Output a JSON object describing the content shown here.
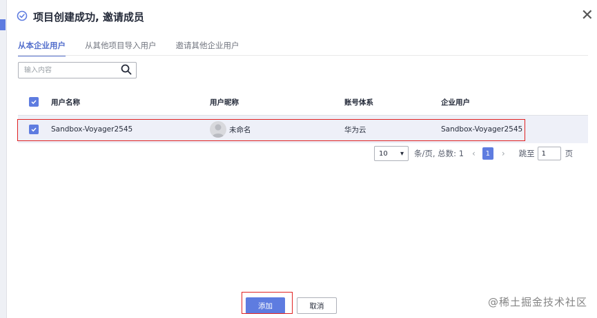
{
  "dialog": {
    "title": "项目创建成功, 邀请成员",
    "close_icon": "close-icon",
    "accent_color": "#5e7ce0"
  },
  "tabs": [
    {
      "label": "从本企业用户",
      "active": true
    },
    {
      "label": "从其他项目导入用户",
      "active": false
    },
    {
      "label": "邀请其他企业用户",
      "active": false
    }
  ],
  "search": {
    "placeholder": "输入内容",
    "icon": "search-icon"
  },
  "table": {
    "headers": [
      "用户名称",
      "用户昵称",
      "账号体系",
      "企业用户"
    ],
    "rows": [
      {
        "checked": true,
        "username": "Sandbox-Voyager2545",
        "nickname": "未命名",
        "account_system": "华为云",
        "enterprise_user": "Sandbox-Voyager2545"
      }
    ]
  },
  "pagination": {
    "page_size": "10",
    "summary": "条/页, 总数: 1",
    "current_page": "1",
    "goto_label": "跳至",
    "goto_value": "1",
    "page_unit": "页"
  },
  "footer": {
    "add_label": "添加",
    "cancel_label": "取消"
  },
  "watermark": "@稀土掘金技术社区"
}
